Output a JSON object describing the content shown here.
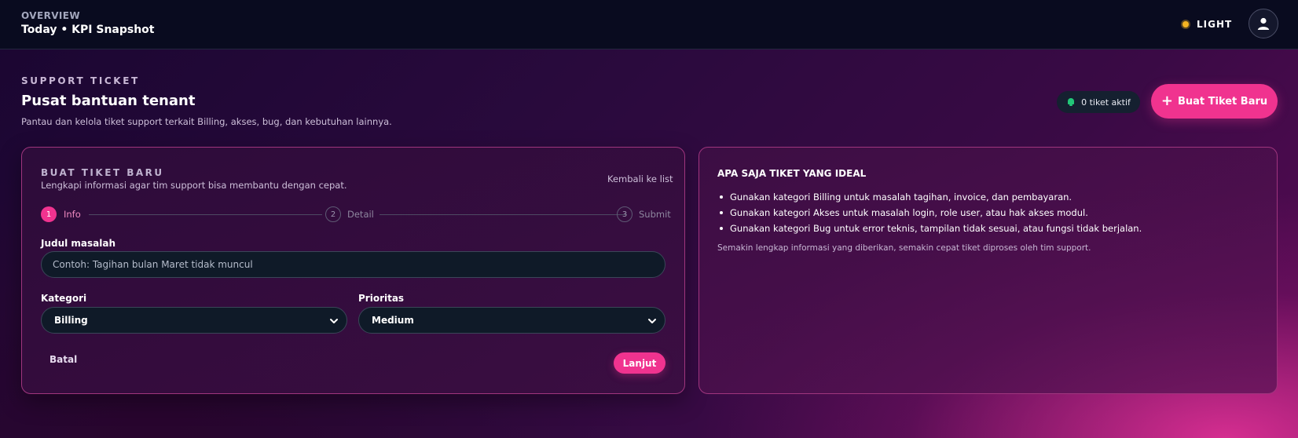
{
  "topbar": {
    "eyebrow": "OVERVIEW",
    "title": "Today • KPI Snapshot",
    "theme_label": "LIGHT",
    "theme_icon": "sun-icon",
    "avatar_icon": "user-icon"
  },
  "header": {
    "eyebrow": "SUPPORT TICKET",
    "title": "Pusat bantuan tenant",
    "subtitle": "Pantau dan kelola tiket support terkait Billing, akses, bug, dan kebutuhan lainnya.",
    "active_tickets": "0 tiket aktif",
    "new_ticket_button": "Buat Tiket Baru"
  },
  "form": {
    "eyebrow": "BUAT TIKET BARU",
    "subtitle": "Lengkapi informasi agar tim support bisa membantu dengan cepat.",
    "back_link": "Kembali ke list",
    "steps": [
      {
        "number": "1",
        "label": "Info",
        "active": true
      },
      {
        "number": "2",
        "label": "Detail",
        "active": false
      },
      {
        "number": "3",
        "label": "Submit",
        "active": false
      }
    ],
    "title_label": "Judul masalah",
    "title_placeholder": "Contoh: Tagihan bulan Maret tidak muncul",
    "category_label": "Kategori",
    "category_value": "Billing",
    "priority_label": "Prioritas",
    "priority_value": "Medium",
    "cancel_button": "Batal",
    "next_button": "Lanjut"
  },
  "tips": {
    "title": "APA SAJA TIKET YANG IDEAL",
    "items": [
      "Gunakan kategori Billing untuk masalah tagihan, invoice, dan pembayaran.",
      "Gunakan kategori Akses untuk masalah login, role user, atau hak akses modul.",
      "Gunakan kategori Bug untuk error teknis, tampilan tidak sesuai, atau fungsi tidak berjalan."
    ],
    "note": "Semakin lengkap informasi yang diberikan, semakin cepat tiket diproses oleh tim support."
  },
  "colors": {
    "accent": "#f0338f",
    "success": "#22c778",
    "topbar_bg": "#090b1f",
    "input_bg": "#0f1a28"
  }
}
